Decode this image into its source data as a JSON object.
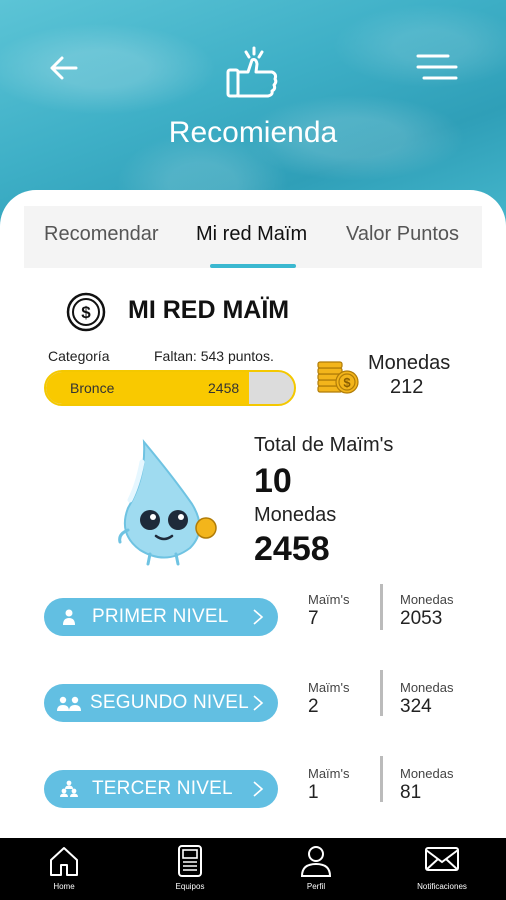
{
  "header": {
    "title": "Recomienda",
    "back_icon": "arrow-left-icon",
    "menu_icon": "menu-icon",
    "title_icon": "thumbs-up-icon"
  },
  "tabs": [
    {
      "label": "Recomendar",
      "active": false
    },
    {
      "label": "Mi red Maïm",
      "active": true
    },
    {
      "label": "Valor Puntos",
      "active": false
    }
  ],
  "section": {
    "title": "MI RED MAÏM",
    "icon": "dollar-coin-icon"
  },
  "category": {
    "label": "Categoría",
    "remaining": "Faltan: 543 puntos.",
    "name": "Bronce",
    "value": "2458",
    "progress_fraction": 0.82
  },
  "coins_summary": {
    "label": "Monedas",
    "value": "212",
    "icon": "coins-stack-icon"
  },
  "totals": {
    "maims_label": "Total de Maïm's",
    "maims_value": "10",
    "monedas_label": "Monedas",
    "monedas_value": "2458",
    "mascot": "water-drop-mascot"
  },
  "levels": [
    {
      "label": "PRIMER NIVEL",
      "icon": "person-icon",
      "maims_label": "Maïm's",
      "maims": "7",
      "monedas_label": "Monedas",
      "monedas": "2053"
    },
    {
      "label": "SEGUNDO NIVEL",
      "icon": "two-people-icon",
      "maims_label": "Maïm's",
      "maims": "2",
      "monedas_label": "Monedas",
      "monedas": "324"
    },
    {
      "label": "TERCER NIVEL",
      "icon": "three-people-icon",
      "maims_label": "Maïm's",
      "maims": "1",
      "monedas_label": "Monedas",
      "monedas": "81"
    }
  ],
  "nav": [
    {
      "label": "Home",
      "icon": "home-icon"
    },
    {
      "label": "Equipos",
      "icon": "equipment-icon"
    },
    {
      "label": "Perfil",
      "icon": "profile-icon"
    },
    {
      "label": "Notificaciones",
      "icon": "mail-icon"
    }
  ],
  "colors": {
    "accent": "#3bb8d0",
    "level_button": "#62bfe2",
    "progress": "#f9c900"
  }
}
